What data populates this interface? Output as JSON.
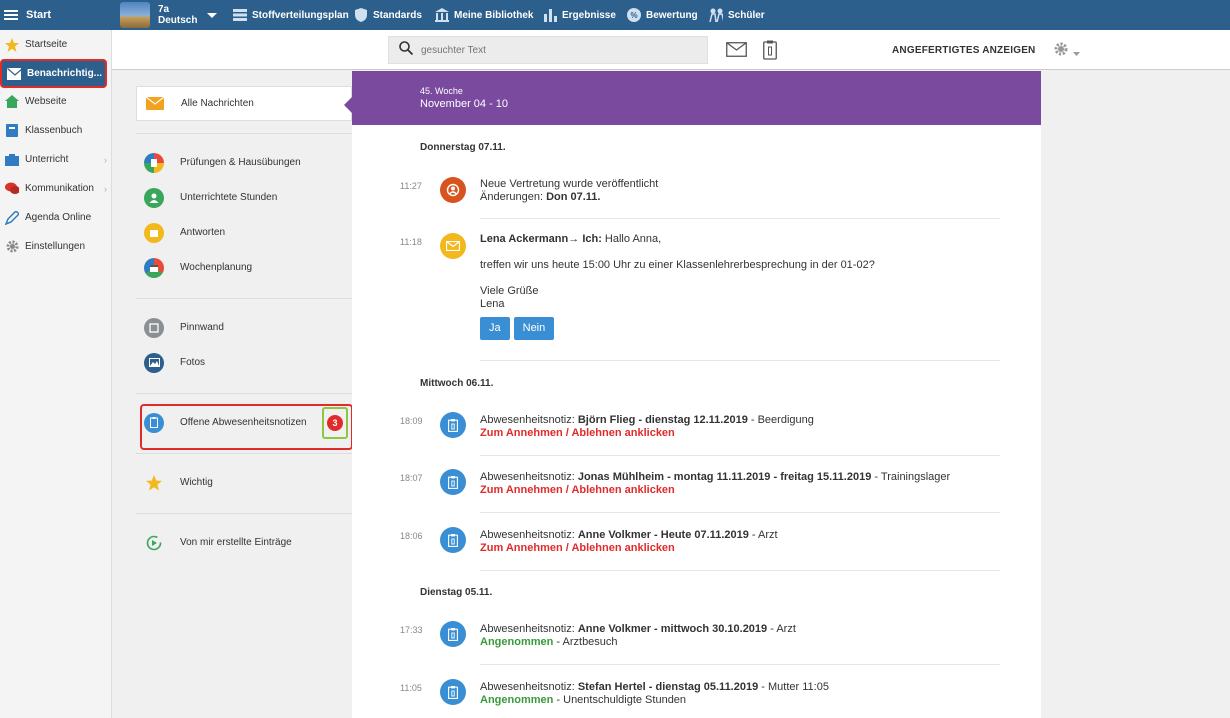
{
  "topbar": {
    "start_label": "Start",
    "class_name": "7a",
    "class_subject": "Deutsch",
    "nav": [
      {
        "label": "Stoffverteilungsplan",
        "icon": "stack-icon"
      },
      {
        "label": "Standards",
        "icon": "shield-icon"
      },
      {
        "label": "Meine Bibliothek",
        "icon": "library-icon"
      },
      {
        "label": "Ergebnisse",
        "icon": "bar-chart-icon"
      },
      {
        "label": "Bewertung",
        "icon": "grade-icon"
      },
      {
        "label": "Schüler",
        "icon": "students-icon"
      }
    ]
  },
  "sidebar": {
    "items": [
      {
        "label": "Startseite",
        "icon": "star-icon"
      },
      {
        "label": "Benachrichtig...",
        "icon": "mail-icon"
      },
      {
        "label": "Webseite",
        "icon": "home-icon"
      },
      {
        "label": "Klassenbuch",
        "icon": "book-icon"
      },
      {
        "label": "Unterricht",
        "icon": "class-icon"
      },
      {
        "label": "Kommunikation",
        "icon": "chat-icon"
      },
      {
        "label": "Agenda Online",
        "icon": "pen-icon"
      },
      {
        "label": "Einstellungen",
        "icon": "gear-icon"
      }
    ]
  },
  "toolbar": {
    "search_placeholder": "gesuchter Text",
    "show_done_label": "ANGEFERTIGTES ANZEIGEN"
  },
  "filters": {
    "all": "Alle Nachrichten",
    "exams": "Prüfungen & Hausübungen",
    "lessons": "Unterrichtete Stunden",
    "answers": "Antworten",
    "weekplan": "Wochenplanung",
    "board": "Pinnwand",
    "photos": "Fotos",
    "absence": "Offene Abwesenheitsnotizen",
    "absence_count": "3",
    "important": "Wichtig",
    "mine": "Von mir erstellte Einträge"
  },
  "feed": {
    "week_label": "45. Woche",
    "week_range": "November 04 - 10",
    "day1": "Donnerstag 07.11.",
    "day2": "Mittwoch 06.11.",
    "day3": "Dienstag 05.11.",
    "e1": {
      "time": "11:27",
      "l1": "Neue Vertretung wurde veröffentlicht",
      "l2a": "Änderungen: ",
      "l2b": "Don 07.11."
    },
    "e2": {
      "time": "11:18",
      "sender": "Lena Ackermann",
      "arrow": "→ ",
      "to": "Ich:",
      "greet": " Hallo Anna,",
      "l2": "treffen wir uns heute 15:00 Uhr zu einer Klassenlehrerbesprechung in der 01-02?",
      "l3": "Viele Grüße",
      "l4": "Lena",
      "yes": "Ja",
      "no": "Nein"
    },
    "prefix": "Abwesenheitsnotiz: ",
    "action": "Zum Annehmen / Ablehnen anklicken",
    "accepted": "Angenommen",
    "e3": {
      "time": "18:09",
      "name": "Björn Flieg",
      "dates": " - dienstag 12.11.2019",
      "reason": " - Beerdigung"
    },
    "e4": {
      "time": "18:07",
      "name": "Jonas Mühlheim",
      "dates": " - montag 11.11.2019 - freitag 15.11.2019",
      "reason": " - Trainingslager"
    },
    "e5": {
      "time": "18:06",
      "name": "Anne Volkmer",
      "dates": " - Heute 07.11.2019",
      "reason": " - Arzt"
    },
    "e6": {
      "time": "17:33",
      "name": "Anne Volkmer",
      "dates": " - mittwoch 30.10.2019",
      "reason": " - Arzt",
      "note": " - Arztbesuch"
    },
    "e7": {
      "time": "11:05",
      "name": "Stefan Hertel",
      "dates": " - dienstag 05.11.2019",
      "reason": " - Mutter 11:05",
      "note": " - Unentschuldigte Stunden"
    }
  },
  "colors": {
    "topbar": "#2c5f8c",
    "week_header": "#7a4a9e",
    "accent_red": "#e02b2b",
    "accent_green": "#3a9a3a",
    "button_blue": "#3a8fd4"
  }
}
